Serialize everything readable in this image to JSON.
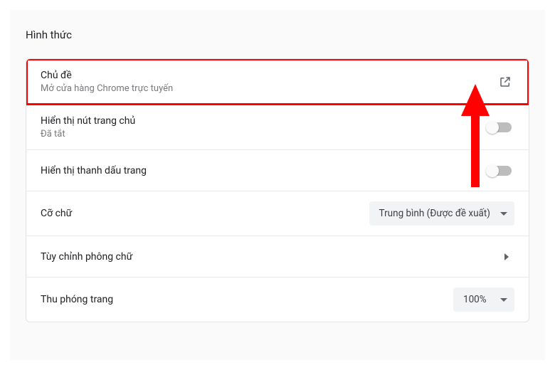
{
  "section_title": "Hình thức",
  "rows": {
    "theme": {
      "title": "Chủ đề",
      "subtitle": "Mở cửa hàng Chrome trực tuyến"
    },
    "home_button": {
      "title": "Hiển thị nút trang chủ",
      "subtitle": "Đã tắt",
      "toggle": false
    },
    "bookmark_bar": {
      "title": "Hiển thị thanh dấu trang",
      "toggle": false
    },
    "font_size": {
      "title": "Cỡ chữ",
      "value": "Trung bình (Được đề xuất)"
    },
    "customize_fonts": {
      "title": "Tùy chỉnh phông chữ"
    },
    "page_zoom": {
      "title": "Thu phóng trang",
      "value": "100%"
    }
  }
}
